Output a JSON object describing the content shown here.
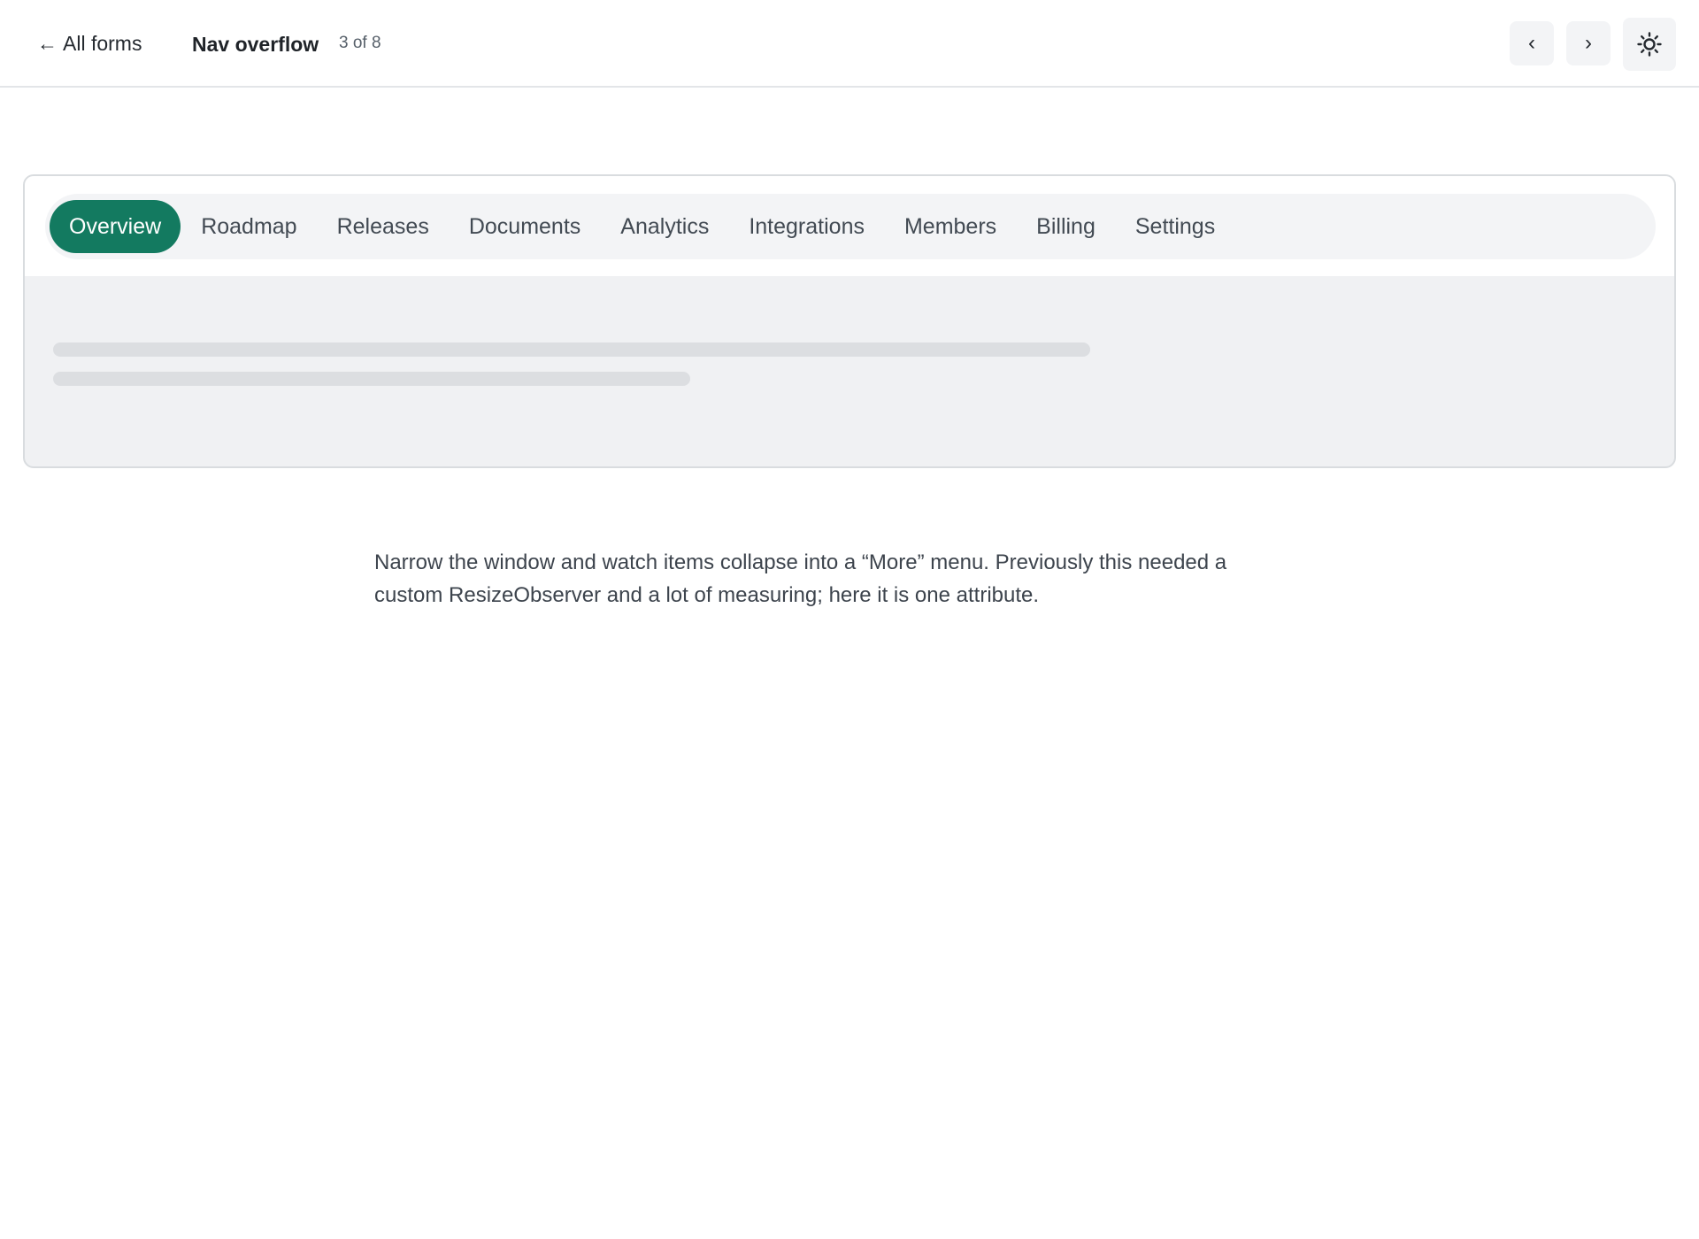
{
  "header": {
    "back_arrow": "←",
    "back_label": "All forms",
    "title": "Nav overflow",
    "counter": "3 of 8",
    "prev_label": "‹",
    "next_label": "›",
    "theme_icon": "sun-icon"
  },
  "demo": {
    "tabs": [
      {
        "label": "Overview",
        "active": true
      },
      {
        "label": "Roadmap",
        "active": false
      },
      {
        "label": "Releases",
        "active": false
      },
      {
        "label": "Documents",
        "active": false
      },
      {
        "label": "Analytics",
        "active": false
      },
      {
        "label": "Integrations",
        "active": false
      },
      {
        "label": "Members",
        "active": false
      },
      {
        "label": "Billing",
        "active": false
      },
      {
        "label": "Settings",
        "active": false
      }
    ]
  },
  "description": "Narrow the window and watch items collapse into a “More” menu. Previously this needed a custom ResizeObserver and a lot of measuring; here it is one attribute.",
  "colors": {
    "accent": "#137a60",
    "tabbar_bg": "#f3f4f6",
    "card_bg": "#f0f1f3"
  }
}
